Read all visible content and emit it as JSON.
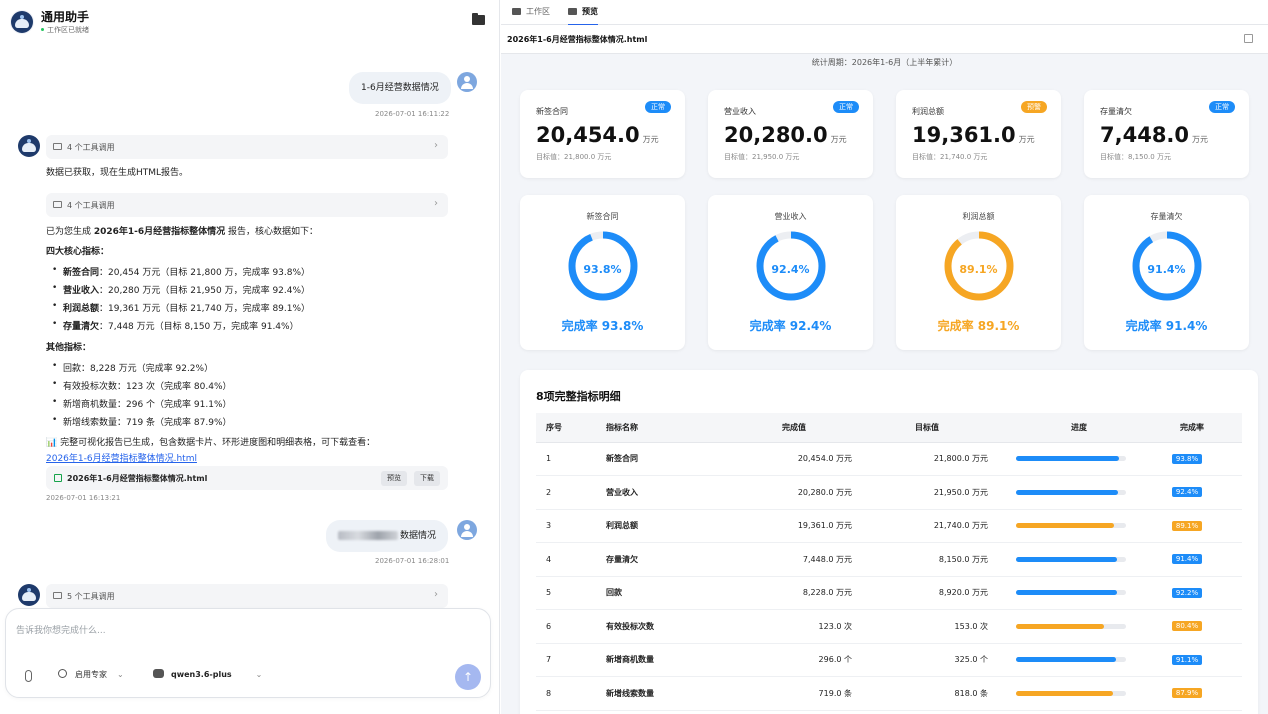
{
  "colors": {
    "blue": "#1d8cf8",
    "orange": "#f6a623",
    "green": "#22c55e",
    "link": "#2563eb"
  },
  "header": {
    "title": "通用助手",
    "status": "工作区已就绪",
    "folder_icon": "folder-icon"
  },
  "chat": {
    "msg1": {
      "text": "1-6月经营数据情况",
      "time": "2026-07-01 16:11:22"
    },
    "tool1": {
      "label": "4 个工具调用"
    },
    "reply1": "数据已获取，现在生成HTML报告。",
    "tool2": {
      "label": "4 个工具调用"
    },
    "reply2_pre": "已为您生成 ",
    "reply2_bold": "2026年1-6月经营指标整体情况",
    "reply2_post": " 报告，核心数据如下：",
    "core_heading": "四大核心指标：",
    "core": [
      {
        "name": "新签合同",
        "rest": "：20,454 万元（目标 21,800 万，完成率 93.8%）"
      },
      {
        "name": "营业收入",
        "rest": "：20,280 万元（目标 21,950 万，完成率 92.4%）"
      },
      {
        "name": "利润总额",
        "rest": "：19,361 万元（目标 21,740 万，完成率 89.1%）"
      },
      {
        "name": "存量清欠",
        "rest": "：7,448 万元（目标 8,150 万，完成率 91.4%）"
      }
    ],
    "other_heading": "其他指标：",
    "other": [
      "回款：8,228 万元（完成率 92.2%）",
      "有效投标次数：123 次（完成率 80.4%）",
      "新增商机数量：296 个（完成率 91.1%）",
      "新增线索数量：719 条（完成率 87.9%）"
    ],
    "summary": "📊 完整可视化报告已生成，包含数据卡片、环形进度图和明细表格，可下载查看：",
    "link": "2026年1-6月经营指标整体情况.html",
    "file": {
      "name": "2026年1-6月经营指标整体情况.html",
      "preview": "预览",
      "download": "下载"
    },
    "reply_time": "2026-07-01 16:13:21",
    "msg2": {
      "text": "数据情况",
      "time": "2026-07-01 16:28:01"
    },
    "tool3": {
      "label": "5 个工具调用"
    }
  },
  "input": {
    "placeholder": "告诉我你想完成什么...",
    "expert": "启用专家",
    "model": "qwen3.6-plus"
  },
  "tabs": {
    "workspace": "工作区",
    "preview": "预览"
  },
  "file_title": "2026年1-6月经营指标整体情况.html",
  "period": "统计周期：2026年1-6月（上半年累计）",
  "kpis": [
    {
      "name": "新签合同",
      "value": "20,454.0",
      "unit": "万元",
      "target": "目标值：21,800.0 万元",
      "badge": "正常",
      "status": "normal"
    },
    {
      "name": "营业收入",
      "value": "20,280.0",
      "unit": "万元",
      "target": "目标值：21,950.0 万元",
      "badge": "正常",
      "status": "normal"
    },
    {
      "name": "利润总额",
      "value": "19,361.0",
      "unit": "万元",
      "target": "目标值：21,740.0 万元",
      "badge": "预警",
      "status": "warn"
    },
    {
      "name": "存量清欠",
      "value": "7,448.0",
      "unit": "万元",
      "target": "目标值：8,150.0 万元",
      "badge": "正常",
      "status": "normal"
    }
  ],
  "rings": [
    {
      "name": "新签合同",
      "pct": 93.8,
      "pct_text": "93.8%",
      "label": "完成率 93.8%",
      "status": "normal"
    },
    {
      "name": "营业收入",
      "pct": 92.4,
      "pct_text": "92.4%",
      "label": "完成率 92.4%",
      "status": "normal"
    },
    {
      "name": "利润总额",
      "pct": 89.1,
      "pct_text": "89.1%",
      "label": "完成率 89.1%",
      "status": "warn"
    },
    {
      "name": "存量清欠",
      "pct": 91.4,
      "pct_text": "91.4%",
      "label": "完成率 91.4%",
      "status": "normal"
    }
  ],
  "table": {
    "title": "8项完整指标明细",
    "headers": [
      "序号",
      "指标名称",
      "完成值",
      "目标值",
      "进度",
      "完成率"
    ],
    "rows": [
      {
        "idx": "1",
        "name": "新签合同",
        "done": "20,454.0 万元",
        "target": "21,800.0 万元",
        "pct": 93.8,
        "rate": "93.8%",
        "status": "normal"
      },
      {
        "idx": "2",
        "name": "营业收入",
        "done": "20,280.0 万元",
        "target": "21,950.0 万元",
        "pct": 92.4,
        "rate": "92.4%",
        "status": "normal"
      },
      {
        "idx": "3",
        "name": "利润总额",
        "done": "19,361.0 万元",
        "target": "21,740.0 万元",
        "pct": 89.1,
        "rate": "89.1%",
        "status": "warn"
      },
      {
        "idx": "4",
        "name": "存量清欠",
        "done": "7,448.0 万元",
        "target": "8,150.0 万元",
        "pct": 91.4,
        "rate": "91.4%",
        "status": "normal"
      },
      {
        "idx": "5",
        "name": "回款",
        "done": "8,228.0 万元",
        "target": "8,920.0 万元",
        "pct": 92.2,
        "rate": "92.2%",
        "status": "normal"
      },
      {
        "idx": "6",
        "name": "有效投标次数",
        "done": "123.0 次",
        "target": "153.0 次",
        "pct": 80.4,
        "rate": "80.4%",
        "status": "warn"
      },
      {
        "idx": "7",
        "name": "新增商机数量",
        "done": "296.0 个",
        "target": "325.0 个",
        "pct": 91.1,
        "rate": "91.1%",
        "status": "normal"
      },
      {
        "idx": "8",
        "name": "新增线索数量",
        "done": "719.0 条",
        "target": "818.0 条",
        "pct": 87.9,
        "rate": "87.9%",
        "status": "warn"
      }
    ]
  }
}
